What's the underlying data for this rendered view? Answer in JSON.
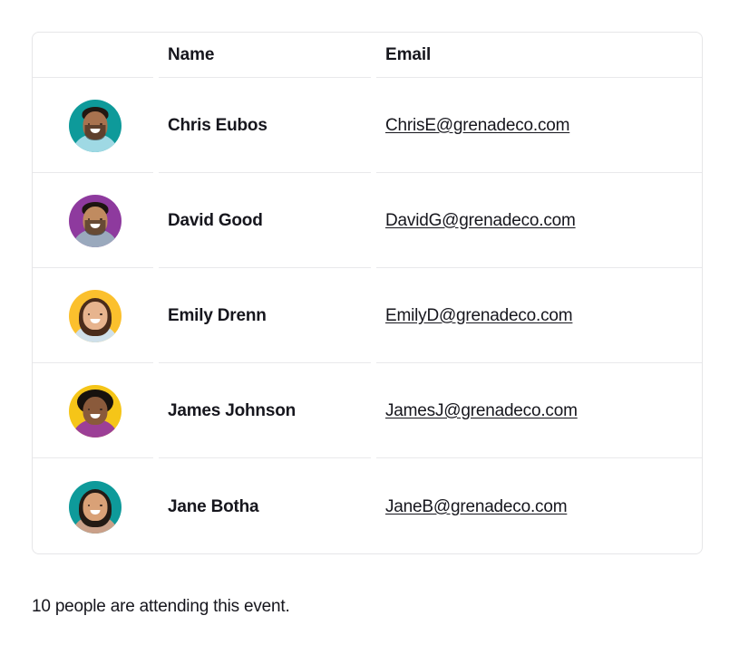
{
  "table": {
    "columns": [
      "",
      "Name",
      "Email"
    ],
    "headers": {
      "avatar": "",
      "name": "Name",
      "email": "Email"
    },
    "rows": [
      {
        "name": "Chris Eubos",
        "email": "ChrisE@grenadeco.com",
        "avatar": {
          "icon": "avatar-photo",
          "background": "#0e9a9a",
          "skin": "#a8724f",
          "hair": "#221812",
          "hair_style": "short",
          "clothing": "#9fd9e4",
          "beard": true
        }
      },
      {
        "name": "David Good",
        "email": "DavidG@grenadeco.com",
        "avatar": {
          "icon": "avatar-photo",
          "background": "#8e3a9e",
          "skin": "#c08b60",
          "hair": "#1d1510",
          "hair_style": "short",
          "clothing": "#9aa9bd",
          "beard": true
        }
      },
      {
        "name": "Emily Drenn",
        "email": "EmilyD@grenadeco.com",
        "avatar": {
          "icon": "avatar-photo",
          "background": "#fbc02d",
          "skin": "#e7b48e",
          "hair": "#4a2c1b",
          "hair_style": "long",
          "clothing": "#cfe0ea",
          "beard": false
        }
      },
      {
        "name": "James Johnson",
        "email": "JamesJ@grenadeco.com",
        "avatar": {
          "icon": "avatar-photo",
          "background": "#f5c518",
          "skin": "#8a5a3b",
          "hair": "#17120e",
          "hair_style": "afro",
          "clothing": "#9c3f96",
          "beard": false
        }
      },
      {
        "name": "Jane Botha",
        "email": "JaneB@grenadeco.com",
        "avatar": {
          "icon": "avatar-photo",
          "background": "#0e9a9a",
          "skin": "#d9a177",
          "hair": "#241a14",
          "hair_style": "long",
          "clothing": "#caa089",
          "beard": false
        }
      }
    ]
  },
  "footer": {
    "attendance_note": "10 people are attending this event."
  },
  "colors": {
    "text": "#16161d",
    "border": "#e6e6e8",
    "separator": "#e9e9eb",
    "background": "#ffffff"
  }
}
